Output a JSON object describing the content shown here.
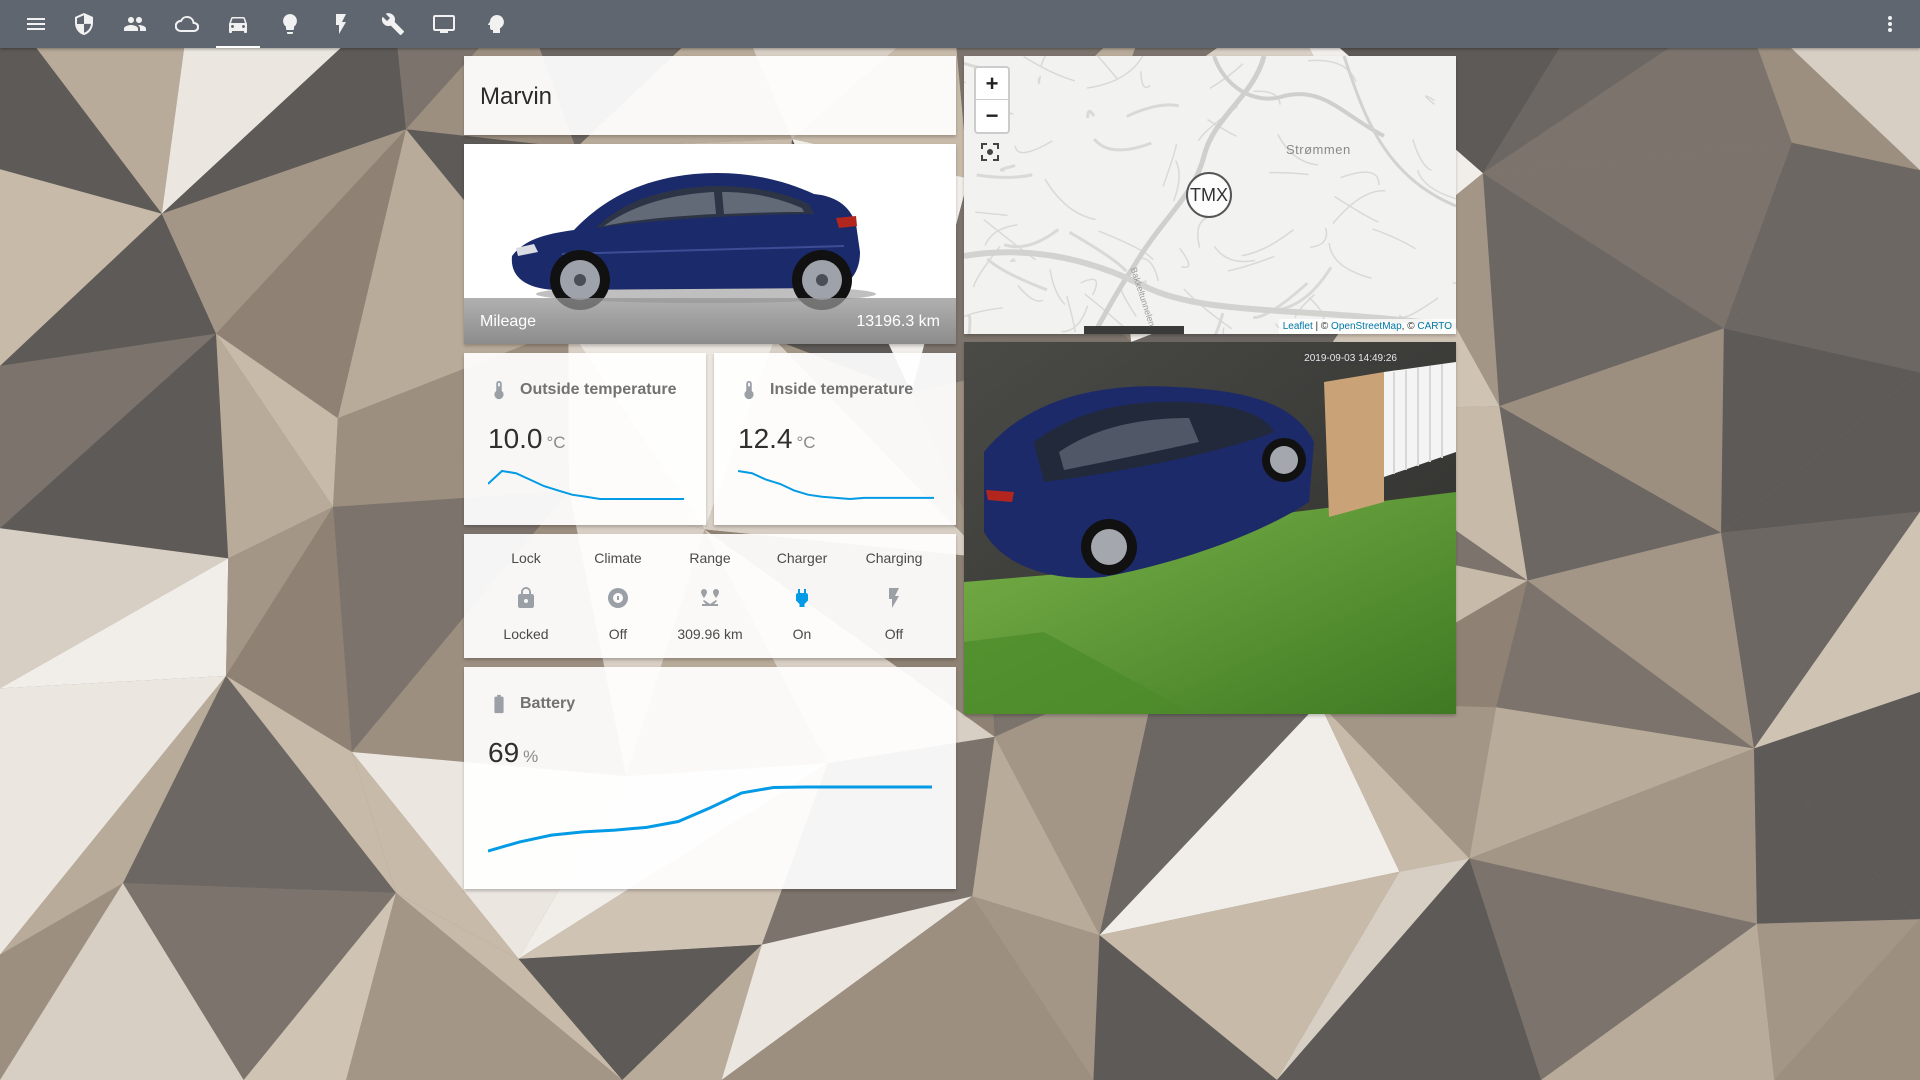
{
  "toolbar": {
    "icons": [
      "menu-icon",
      "shield-icon",
      "people-icon",
      "cloud-icon",
      "car-icon",
      "bulb-icon",
      "flash-icon",
      "wrench-icon",
      "monitor-icon",
      "brain-icon"
    ],
    "active": "car-icon",
    "overflow_icon": "more-vertical-icon"
  },
  "title_card": {
    "title": "Marvin"
  },
  "car_card": {
    "mileage_label": "Mileage",
    "mileage_value": "13196.3 km",
    "car_color": "#1b2a6b"
  },
  "outside_temp": {
    "name": "Outside temperature",
    "value": "10.0",
    "unit": "°C",
    "icon": "thermometer-icon",
    "history": [
      1.0,
      1.6,
      1.5,
      1.2,
      0.9,
      0.7,
      0.5,
      0.4,
      0.3,
      0.3,
      0.3,
      0.3,
      0.3,
      0.3,
      0.3
    ]
  },
  "inside_temp": {
    "name": "Inside temperature",
    "value": "12.4",
    "unit": "°C",
    "icon": "thermometer-icon",
    "history": [
      1.6,
      1.5,
      1.2,
      1.0,
      0.7,
      0.5,
      0.4,
      0.35,
      0.3,
      0.35,
      0.35,
      0.35,
      0.35,
      0.35,
      0.35
    ]
  },
  "glance": {
    "items": [
      {
        "name": "Lock",
        "state": "Locked",
        "icon": "lock-icon",
        "active": false
      },
      {
        "name": "Climate",
        "state": "Off",
        "icon": "climate-icon",
        "active": false
      },
      {
        "name": "Range",
        "state": "309.96 km",
        "icon": "range-icon",
        "active": false
      },
      {
        "name": "Charger",
        "state": "On",
        "icon": "plug-icon",
        "active": true
      },
      {
        "name": "Charging",
        "state": "Off",
        "icon": "flash-icon",
        "active": false
      }
    ]
  },
  "battery": {
    "name": "Battery",
    "value": "69",
    "unit": "%",
    "icon": "battery-icon",
    "history": [
      55,
      57,
      58.5,
      59.2,
      59.6,
      60.2,
      61.5,
      64.5,
      67.8,
      69.0,
      69.1,
      69.1,
      69.1,
      69.1,
      69.1
    ]
  },
  "map": {
    "zoom_in": "+",
    "zoom_out": "−",
    "marker": "TMX",
    "place": "Strømmen",
    "road": "Bakkeltunnelen",
    "attribution": {
      "leaflet": "Leaflet",
      "sep1": " | © ",
      "osm": "OpenStreetMap",
      "sep2": ", © ",
      "carto": "CARTO"
    }
  },
  "camera": {
    "timestamp": "2019-09-03 14:49:26"
  },
  "colors": {
    "accent": "#039be5",
    "toolbar": "#5f6670",
    "card": "#ffffff",
    "icon_inactive": "#9aa0a6"
  }
}
